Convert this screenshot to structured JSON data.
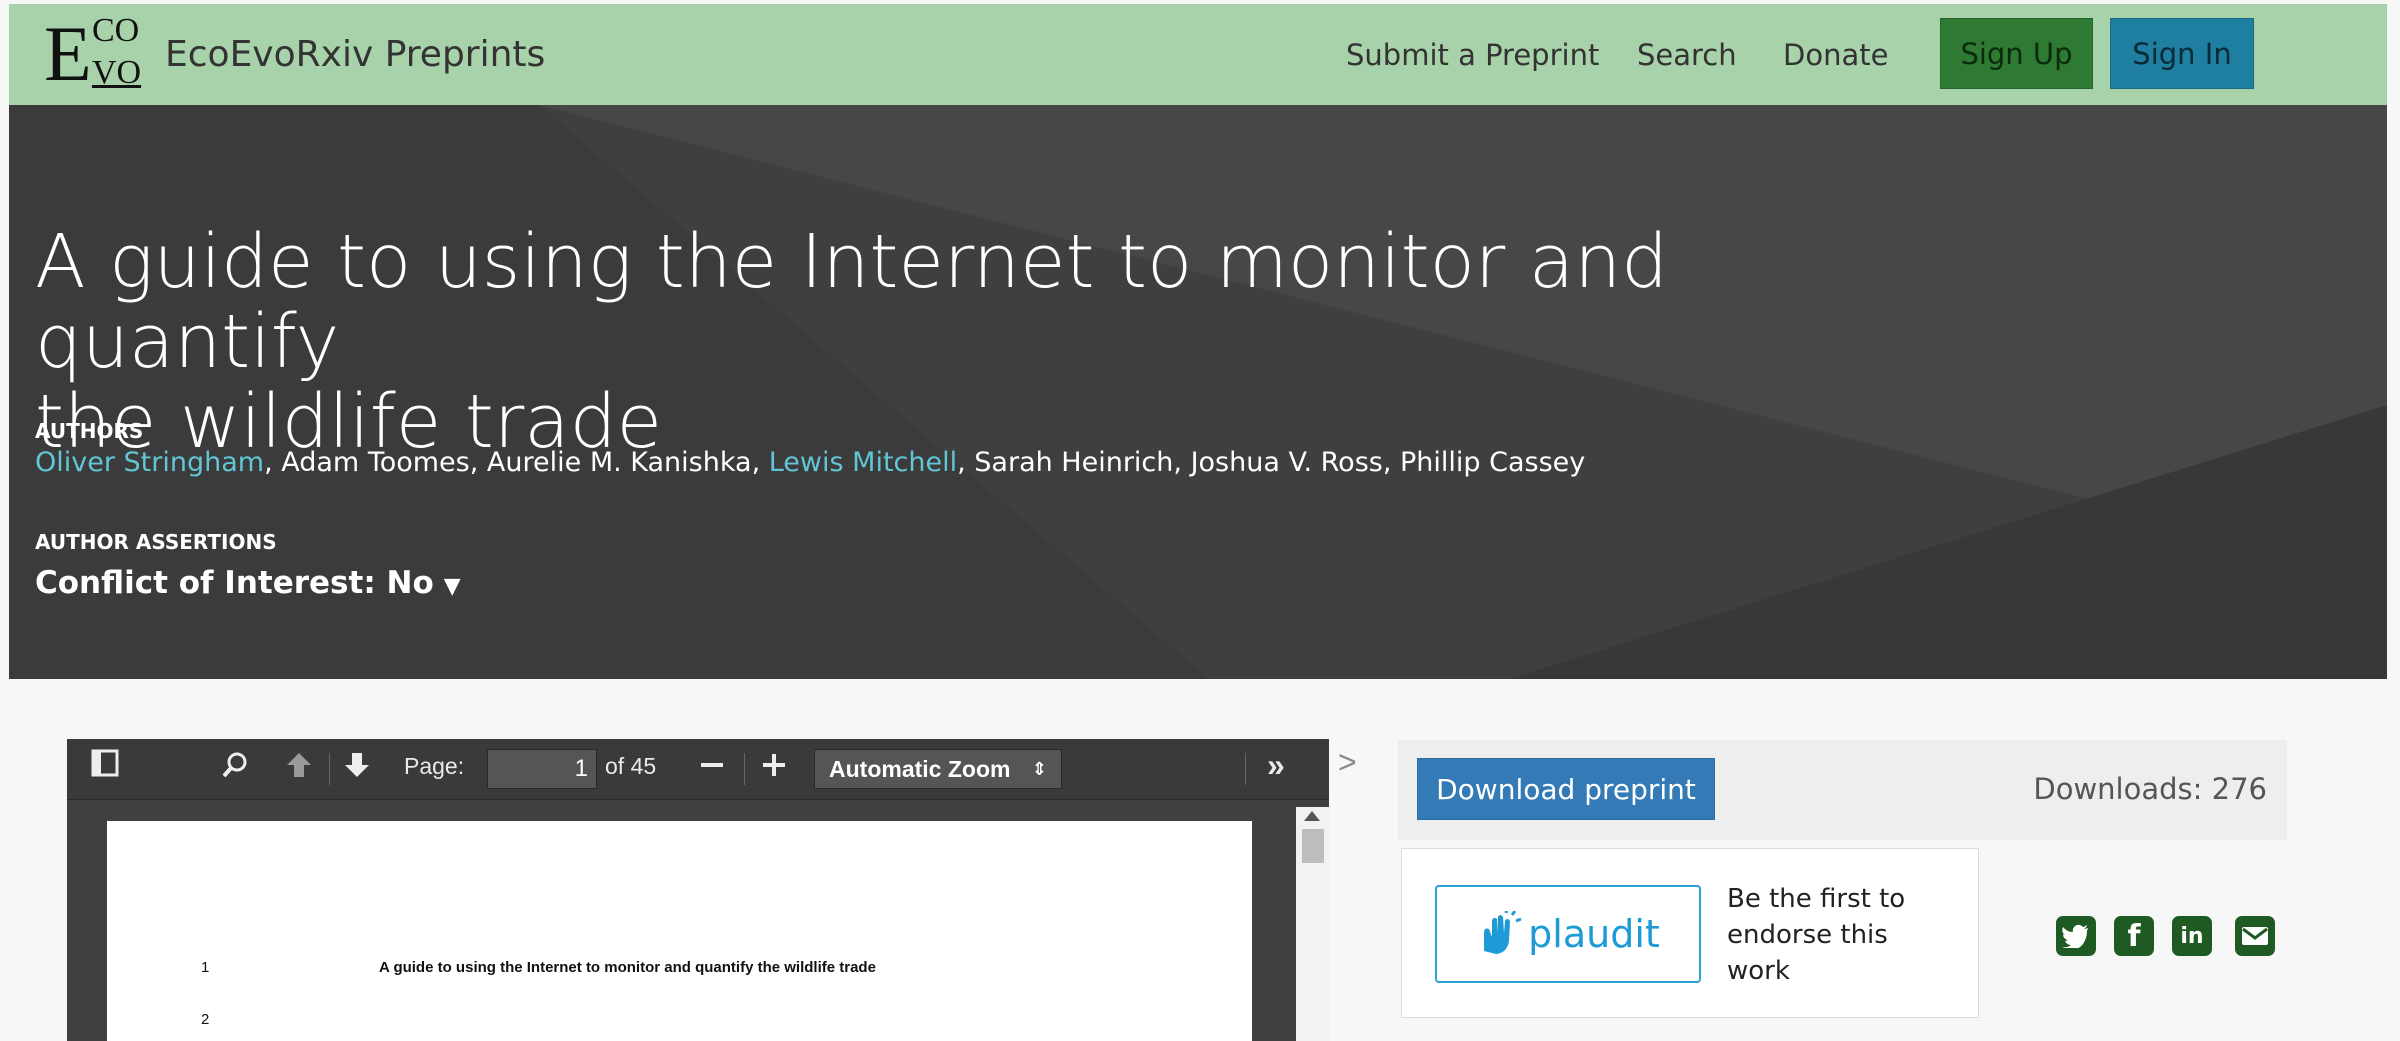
{
  "navbar": {
    "logo": {
      "big_letter": "E",
      "top": "CO",
      "bottom": "VO"
    },
    "brand": "EcoEvoRxiv Preprints",
    "links": [
      "Submit a Preprint",
      "Search",
      "Donate"
    ],
    "signup_label": "Sign Up",
    "signin_label": "Sign In",
    "colors": {
      "bar": "#a8d2aa",
      "signup": "#2f7a32",
      "signin": "#1f7fa0"
    }
  },
  "header": {
    "title_line1": "A guide to using the Internet to monitor and quantify",
    "title_line2": "the wildlife trade",
    "authors_label": "AUTHORS",
    "authors": [
      {
        "name": "Oliver Stringham",
        "linked": true
      },
      {
        "name": "Adam Toomes",
        "linked": false
      },
      {
        "name": "Aurelie M. Kanishka",
        "linked": false
      },
      {
        "name": "Lewis Mitchell",
        "linked": true
      },
      {
        "name": "Sarah Heinrich",
        "linked": false
      },
      {
        "name": "Joshua V. Ross",
        "linked": false
      },
      {
        "name": "Phillip Cassey",
        "linked": false
      }
    ],
    "assertions_label": "AUTHOR ASSERTIONS",
    "conflict_of_interest": "Conflict of Interest: No"
  },
  "viewer": {
    "page_label": "Page:",
    "page_value": "1",
    "page_total": "of 45",
    "zoom_value": "Automatic Zoom",
    "icons": [
      "sidebar-toggle-icon",
      "search-icon",
      "previous-page-icon",
      "next-page-icon",
      "zoom-out-icon",
      "zoom-in-icon",
      "tools-icon"
    ],
    "pdf_lines": [
      {
        "number": "1",
        "text": "A guide to using the Internet to monitor and quantify the wildlife trade"
      },
      {
        "number": "2",
        "text": ""
      }
    ]
  },
  "sidebar": {
    "download_label": "Download preprint",
    "downloads_text": "Downloads: 276",
    "plaudit_word": "plaudit",
    "endorse_text": "Be the first to endorse this work",
    "share_icons": [
      "twitter-icon",
      "facebook-icon",
      "linkedin-icon",
      "email-icon"
    ]
  }
}
